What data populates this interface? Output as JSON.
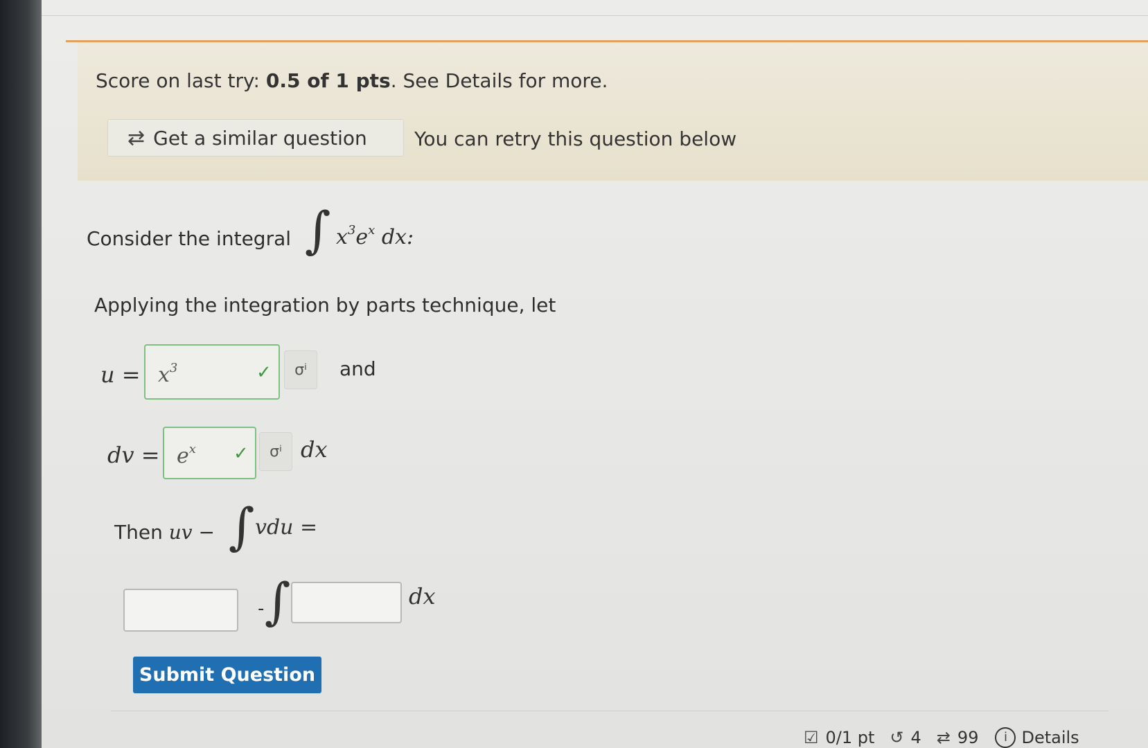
{
  "banner": {
    "score_prefix": "Score on last try: ",
    "score_value": "0.5 of 1 pts",
    "score_suffix": ". See Details for more.",
    "similar_button_label": "Get a similar question",
    "retry_note": "You can retry this question below"
  },
  "question": {
    "consider_text": "Consider the integral",
    "integrand_x": "x",
    "integrand_x_exp": "3",
    "integrand_e": "e",
    "integrand_e_exp": "x",
    "integrand_dx": "dx:",
    "applying_text": "Applying the integration by parts technique, let",
    "u_label": "u =",
    "u_answer_base": "x",
    "u_answer_exp": "3",
    "and_text": "and",
    "dv_label": "dv =",
    "dv_answer_base": "e",
    "dv_answer_exp": "x",
    "dv_suffix": "dx",
    "then_prefix": "Then",
    "then_uv": "uv −",
    "then_vdu": "vdu =",
    "minus": "-",
    "final_dx": "dx",
    "check_icon": "check-icon",
    "symbol_icon": "math-symbol-icon"
  },
  "submit_label": "Submit Question",
  "footer": {
    "points": "0/1 pt",
    "retries": "4",
    "similar_count": "99",
    "details": "Details"
  }
}
